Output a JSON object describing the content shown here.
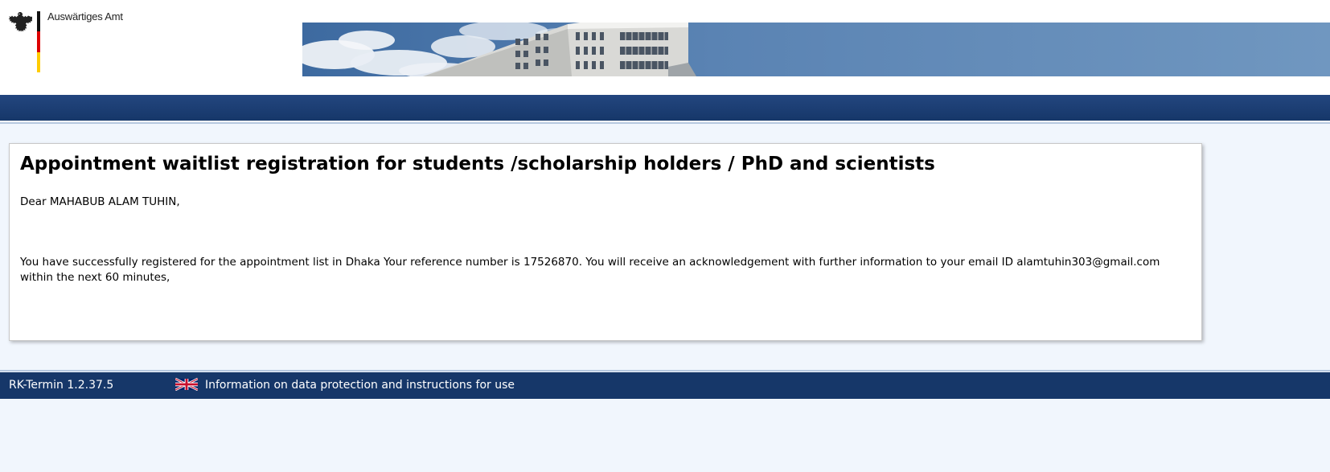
{
  "header": {
    "logo_text": "Auswärtiges Amt"
  },
  "main": {
    "title": "Appointment waitlist registration for students /scholarship holders / PhD and scientists",
    "greeting": "Dear MAHABUB ALAM TUHIN,",
    "message": "You have successfully registered for the appointment list in Dhaka Your reference number is 17526870. You will receive an acknowledgement with further information to your email ID alamtuhin303@gmail.com within the next 60 minutes,"
  },
  "footer": {
    "version": "RK-Termin 1.2.37.5",
    "language_icon": "uk-flag-icon",
    "link_text": "Information on data protection and instructions for use"
  },
  "colors": {
    "nav_blue": "#163769",
    "page_background": "#f1f6fd",
    "flag_black": "#111111",
    "flag_red": "#dd0000",
    "flag_gold": "#ffcc00"
  }
}
